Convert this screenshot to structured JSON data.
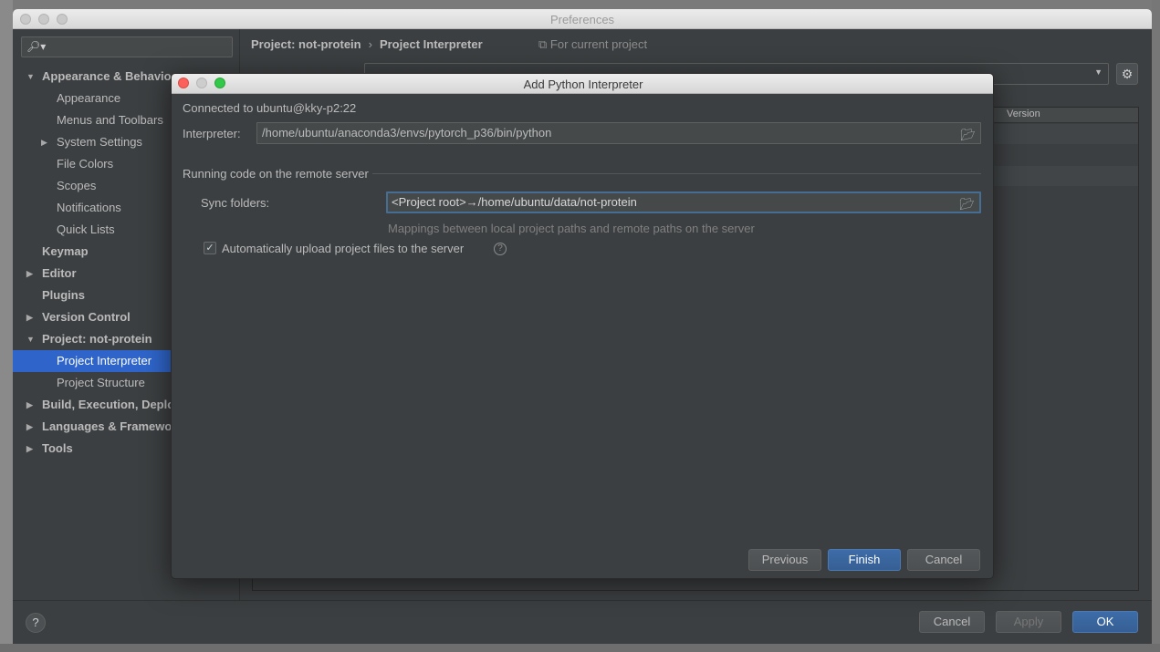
{
  "preferences": {
    "title": "Preferences",
    "breadcrumb": [
      "Project: not-protein",
      "Project Interpreter"
    ],
    "breadcrumb_sep": "›",
    "for_current_project": "For current project",
    "table_version_header": "Version",
    "footer": {
      "help_label": "?",
      "cancel_label": "Cancel",
      "apply_label": "Apply",
      "ok_label": "OK"
    }
  },
  "sidebar": {
    "search_placeholder": "",
    "items": [
      {
        "label": "Appearance & Behavior",
        "level": 0,
        "arrow": "▼"
      },
      {
        "label": "Appearance",
        "level": 1,
        "arrow": ""
      },
      {
        "label": "Menus and Toolbars",
        "level": 1,
        "arrow": ""
      },
      {
        "label": "System Settings",
        "level": 1,
        "arrow": "▶"
      },
      {
        "label": "File Colors",
        "level": 1,
        "arrow": ""
      },
      {
        "label": "Scopes",
        "level": 1,
        "arrow": ""
      },
      {
        "label": "Notifications",
        "level": 1,
        "arrow": ""
      },
      {
        "label": "Quick Lists",
        "level": 1,
        "arrow": ""
      },
      {
        "label": "Keymap",
        "level": 0,
        "arrow": ""
      },
      {
        "label": "Editor",
        "level": 0,
        "arrow": "▶"
      },
      {
        "label": "Plugins",
        "level": 0,
        "arrow": ""
      },
      {
        "label": "Version Control",
        "level": 0,
        "arrow": "▶"
      },
      {
        "label": "Project: not-protein",
        "level": 0,
        "arrow": "▼"
      },
      {
        "label": "Project Interpreter",
        "level": 1,
        "arrow": "",
        "selected": true
      },
      {
        "label": "Project Structure",
        "level": 1,
        "arrow": ""
      },
      {
        "label": "Build, Execution, Deployment",
        "level": 0,
        "arrow": "▶"
      },
      {
        "label": "Languages & Frameworks",
        "level": 0,
        "arrow": "▶"
      },
      {
        "label": "Tools",
        "level": 0,
        "arrow": "▶"
      }
    ]
  },
  "dialog": {
    "title": "Add Python Interpreter",
    "connected_to": "Connected to ubuntu@kky-p2:22",
    "interpreter_label": "Interpreter:",
    "interpreter_value": "/home/ubuntu/anaconda3/envs/pytorch_p36/bin/python",
    "section_title": "Running code on the remote server",
    "sync_label": "Sync folders:",
    "sync_value": "<Project root>→/home/ubuntu/data/not-protein",
    "sync_hint": "Mappings between local project paths and remote paths on the server",
    "auto_upload_label": "Automatically upload project files to the server",
    "auto_upload_checked": true,
    "buttons": {
      "previous": "Previous",
      "finish": "Finish",
      "cancel": "Cancel"
    }
  },
  "colors": {
    "background": "#3c3f41",
    "selection": "#2f65ca",
    "primary_button": "#365f94",
    "focus_border": "#466d94"
  }
}
